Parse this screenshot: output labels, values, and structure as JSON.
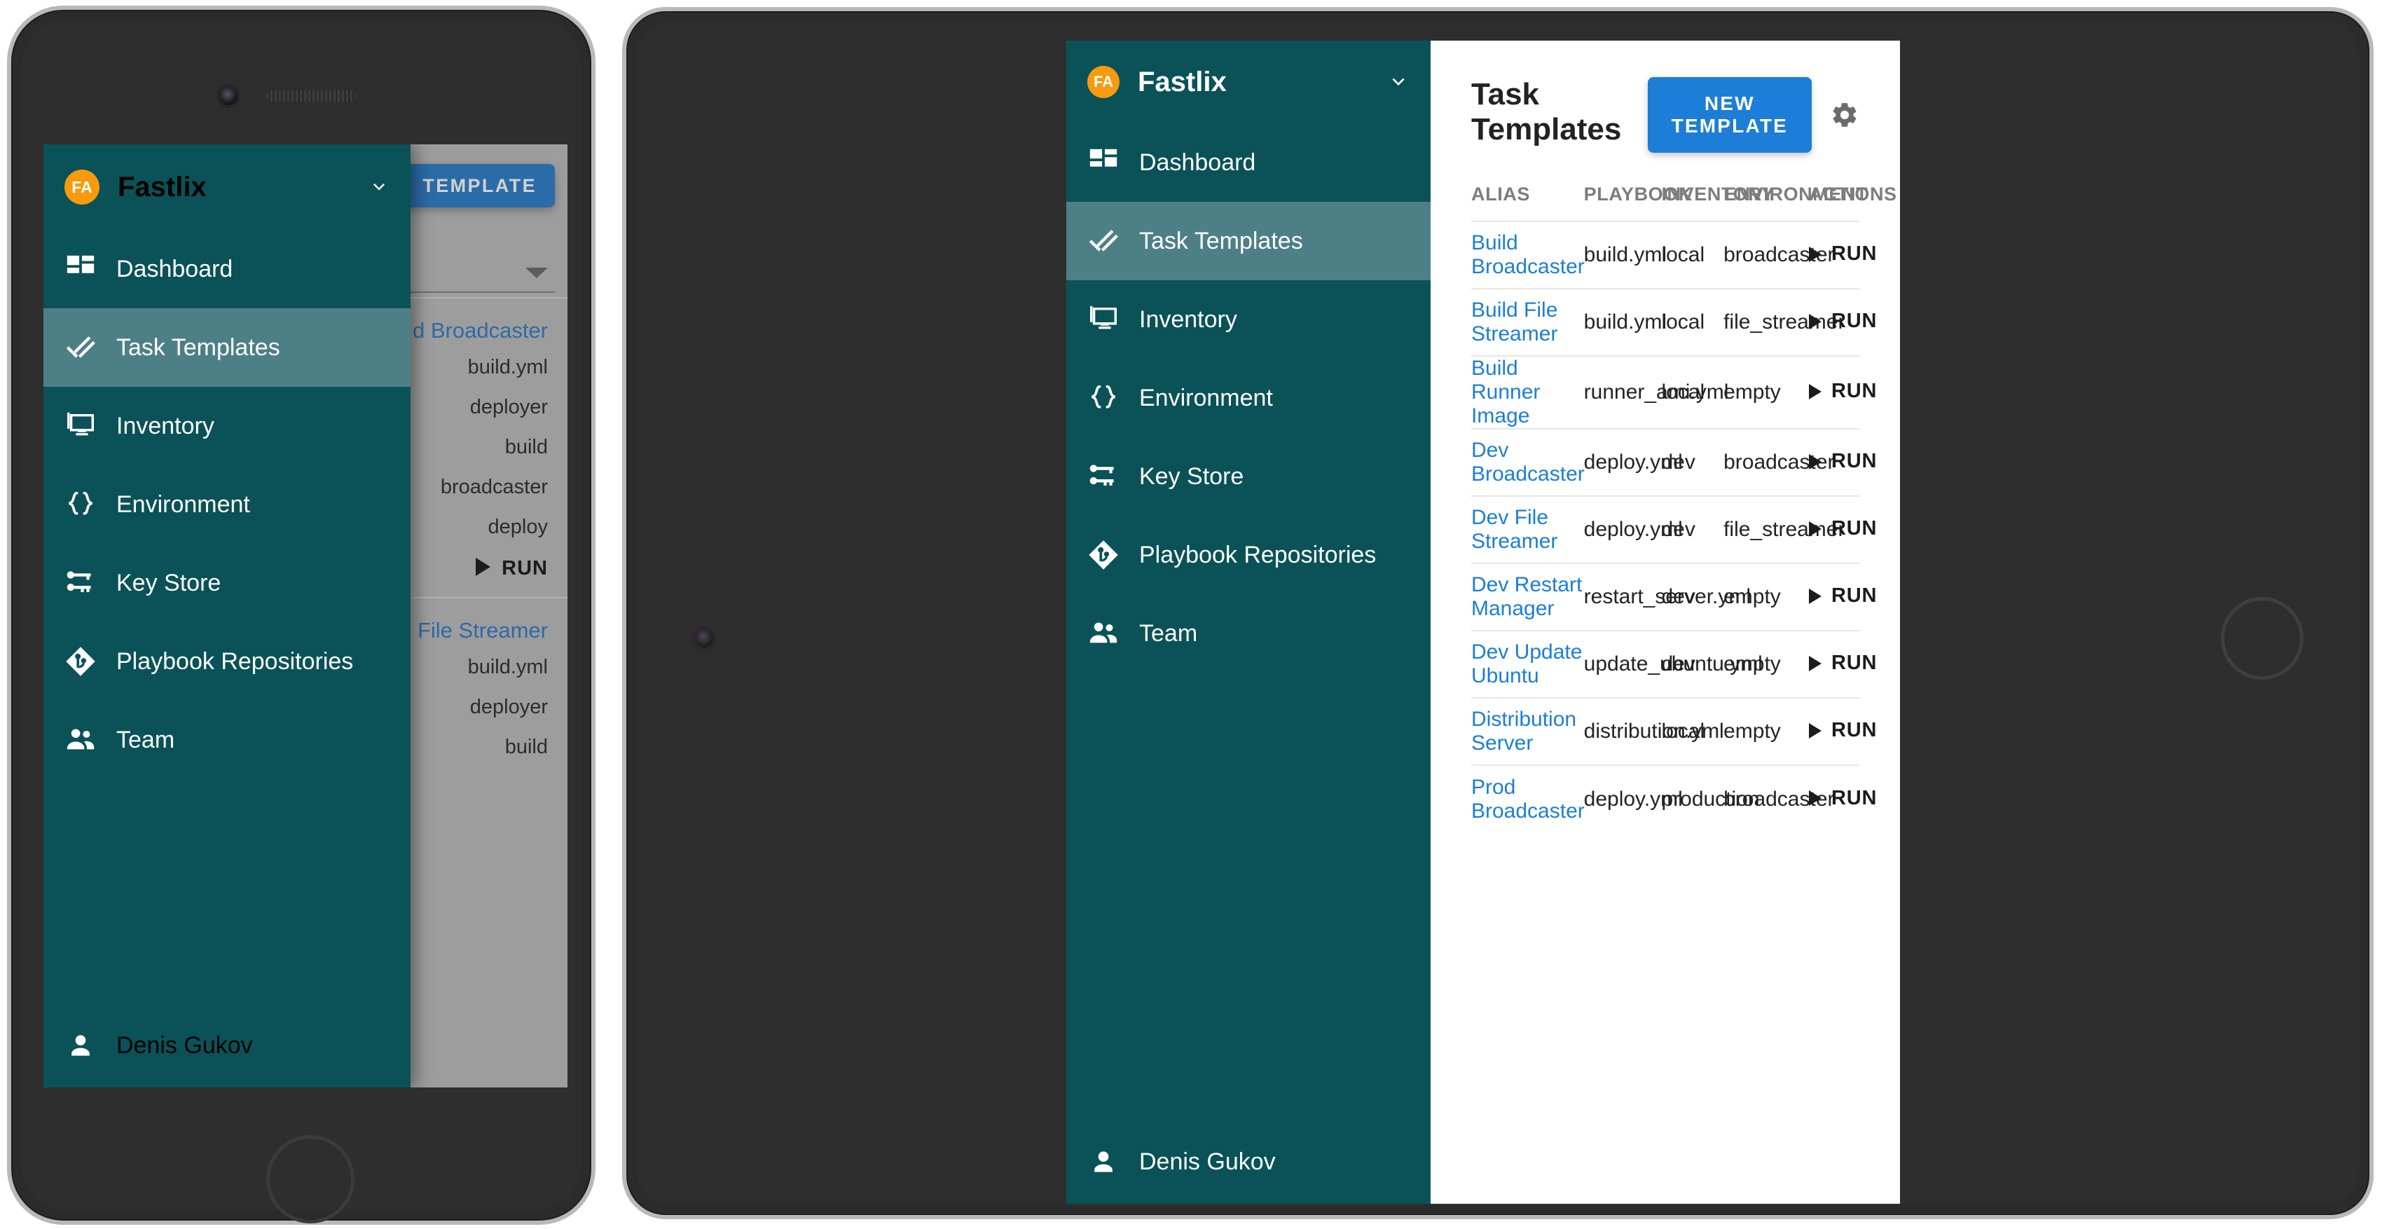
{
  "app": {
    "brand_initials": "FA",
    "brand_name": "Fastlix",
    "brand_caret_icon": "chevron-down-icon",
    "accent_teal": "#0a5257",
    "accent_teal_active": "#4d8086",
    "accent_orange": "#f79a0e",
    "accent_blue": "#1c7ed6",
    "link_blue": "#1c7ed6"
  },
  "sidebar": {
    "items": [
      {
        "label": "Dashboard",
        "icon": "dashboard-grid-icon",
        "active": false
      },
      {
        "label": "Task Templates",
        "icon": "double-check-icon",
        "active": true
      },
      {
        "label": "Inventory",
        "icon": "monitor-icon",
        "active": false
      },
      {
        "label": "Environment",
        "icon": "curly-braces-icon",
        "active": false
      },
      {
        "label": "Key Store",
        "icon": "key-icon",
        "active": false
      },
      {
        "label": "Playbook Repositories",
        "icon": "git-branch-diamond-icon",
        "active": false
      },
      {
        "label": "Team",
        "icon": "people-icon",
        "active": false
      }
    ],
    "user": {
      "name": "Denis Gukov",
      "icon": "person-icon"
    }
  },
  "main": {
    "title": "Task Templates",
    "new_template_label": "NEW TEMPLATE",
    "settings_icon": "gear-icon",
    "columns": [
      "ALIAS",
      "PLAYBOOK",
      "INVENTORY",
      "ENVIRONMENT",
      "ACTIONS"
    ],
    "run_label": "RUN",
    "run_icon": "play-triangle-icon",
    "rows": [
      {
        "alias": "Build Broadcaster",
        "playbook": "build.yml",
        "inventory": "local",
        "environment": "broadcaster"
      },
      {
        "alias": "Build File Streamer",
        "playbook": "build.yml",
        "inventory": "local",
        "environment": "file_streamer"
      },
      {
        "alias": "Build Runner Image",
        "playbook": "runner_ami.yml",
        "inventory": "local",
        "environment": "empty"
      },
      {
        "alias": "Dev Broadcaster",
        "playbook": "deploy.yml",
        "inventory": "dev",
        "environment": "broadcaster"
      },
      {
        "alias": "Dev File Streamer",
        "playbook": "deploy.yml",
        "inventory": "dev",
        "environment": "file_streamer"
      },
      {
        "alias": "Dev Restart Manager",
        "playbook": "restart_server.yml",
        "inventory": "dev",
        "environment": "empty"
      },
      {
        "alias": "Dev Update Ubuntu",
        "playbook": "update_ubuntu.yml",
        "inventory": "dev",
        "environment": "empty"
      },
      {
        "alias": "Distribution Server",
        "playbook": "distribution.yml",
        "inventory": "local",
        "environment": "empty"
      },
      {
        "alias": "Prod Broadcaster",
        "playbook": "deploy.yml",
        "inventory": "production",
        "environment": "broadcaster"
      }
    ]
  },
  "phone": {
    "new_template_label": "TEMPLATE",
    "cards": [
      {
        "alias": "d Broadcaster",
        "playbook": "build.yml",
        "inventory": "deployer",
        "environment": "build",
        "extra1": "broadcaster",
        "extra2": "deploy",
        "run": "RUN"
      },
      {
        "alias": "File Streamer",
        "playbook": "build.yml",
        "inventory": "deployer",
        "environment": "build",
        "extra1": "",
        "extra2": "",
        "run": ""
      }
    ],
    "user": {
      "name": "Denis Gukov"
    }
  }
}
